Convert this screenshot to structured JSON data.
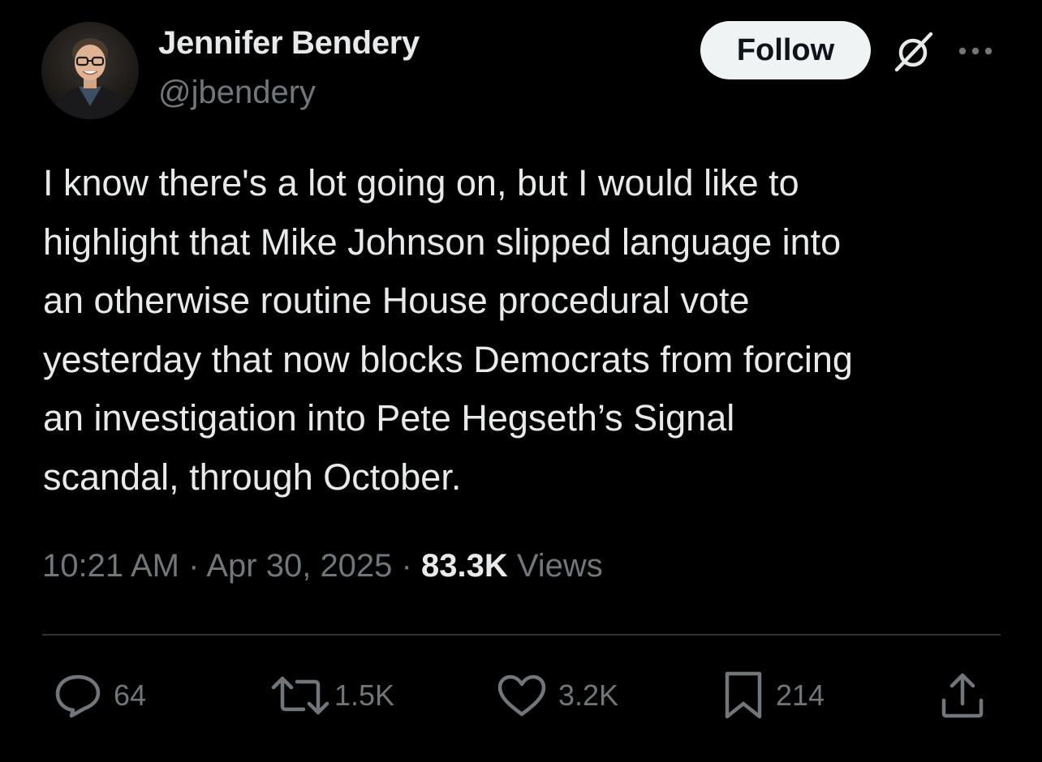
{
  "author": {
    "display_name": "Jennifer Bendery",
    "handle": "@jbendery"
  },
  "header": {
    "follow_label": "Follow",
    "grok_icon": "grok-icon",
    "more_icon": "more-options-icon"
  },
  "tweet": {
    "text": "I know there's a lot going on, but I would like to\nhighlight that Mike Johnson slipped language into\nan otherwise routine House procedural vote\nyesterday that now blocks Democrats from forcing\nan investigation into Pete Hegseth’s Signal\nscandal, through October.",
    "time": "10:21 AM",
    "separator": " · ",
    "date": "Apr 30, 2025",
    "views_count": "83.3K",
    "views_label": " Views"
  },
  "actions": {
    "replies": "64",
    "reposts": "1.5K",
    "likes": "3.2K",
    "bookmarks": "214"
  },
  "colors": {
    "background": "#000000",
    "primary_text": "#e7e9ea",
    "secondary_text": "#71767b",
    "follow_bg": "#eff3f4",
    "divider": "#2f3336"
  }
}
